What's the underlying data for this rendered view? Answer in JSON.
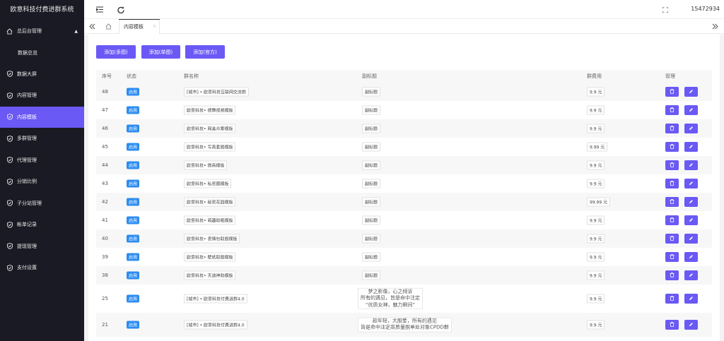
{
  "app": {
    "title": "欧意科技付费进群系统",
    "user": "15472934"
  },
  "sidebar": {
    "parent": {
      "label": "总后台管理"
    },
    "sub": {
      "label": "数据总览"
    },
    "items": [
      {
        "label": "数据大屏"
      },
      {
        "label": "内容管理"
      },
      {
        "label": "内容模板"
      },
      {
        "label": "多群管理"
      },
      {
        "label": "代理管理"
      },
      {
        "label": "分销比例"
      },
      {
        "label": "子分站管理"
      },
      {
        "label": "帐单记录"
      },
      {
        "label": "提现管理"
      },
      {
        "label": "支付设置"
      }
    ]
  },
  "tabs": {
    "active": "内容模板",
    "close": "×"
  },
  "toolbar": {
    "add_multi": "添加(多图)",
    "add_single": "添加(单图)",
    "add_official": "添加(官方)"
  },
  "table": {
    "headers": {
      "id": "序号",
      "status": "状态",
      "name": "群名称",
      "subtitle": "副标题",
      "fee": "群费用",
      "manage": "管理"
    },
    "rows": [
      {
        "id": "48",
        "status": "启用",
        "name": "[城市] • 欧意科技互联网交流群",
        "subtitle": [
          "副标题"
        ],
        "fee": "9.9 元"
      },
      {
        "id": "47",
        "status": "启用",
        "name": "欧意科技• 德舞视频模板",
        "subtitle": [
          "副标题"
        ],
        "fee": "9.9 元"
      },
      {
        "id": "46",
        "status": "启用",
        "name": "欧意科技• 网美众筹模板",
        "subtitle": [
          "副标题"
        ],
        "fee": "9.9 元"
      },
      {
        "id": "45",
        "status": "启用",
        "name": "欧意科技• 写真套图模板",
        "subtitle": [
          "副标题"
        ],
        "fee": "9.99 元"
      },
      {
        "id": "44",
        "status": "启用",
        "name": "欧意科技• 微商模板",
        "subtitle": [
          "副标题"
        ],
        "fee": "9.9 元"
      },
      {
        "id": "43",
        "status": "启用",
        "name": "欧意科技• 私密圈模板",
        "subtitle": [
          "副标题"
        ],
        "fee": "9.9 元"
      },
      {
        "id": "42",
        "status": "启用",
        "name": "欧意科技• 秘密花园模板",
        "subtitle": [
          "副标题"
        ],
        "fee": "99.99 元"
      },
      {
        "id": "41",
        "status": "启用",
        "name": "欧意科技• 萌趣助眠模板",
        "subtitle": [
          "副标题"
        ],
        "fee": "9.9 元"
      },
      {
        "id": "40",
        "status": "启用",
        "name": "欧意科技• 表情包取图模板",
        "subtitle": [
          "副标题"
        ],
        "fee": "9.9 元"
      },
      {
        "id": "39",
        "status": "启用",
        "name": "欧意科技• 壁纸取图模板",
        "subtitle": [
          "副标题"
        ],
        "fee": "9.9 元"
      },
      {
        "id": "38",
        "status": "启用",
        "name": "欧意科技• 天道神助模板",
        "subtitle": [
          "副标题"
        ],
        "fee": "9.9 元"
      },
      {
        "id": "25",
        "status": "启用",
        "name": "[城市] • 欧意科技付费进群4.0",
        "subtitle": [
          "梦之影像，心之倾诉",
          "所有的遇见，皆是命中注定",
          "“优质女神，魅力瞬间”"
        ],
        "fee": "9.9 元"
      },
      {
        "id": "21",
        "status": "启用",
        "name": "[城市] • 欧意科技付费进群4.0",
        "subtitle": [
          "趁年轻，大胆爱，所有的遇见",
          "皆是命中注定高质量脱单处对象CPDD群"
        ],
        "fee": "9.9 元"
      }
    ]
  },
  "colors": {
    "accent": "#6a59f5",
    "sidebar": "#191a23",
    "badge": "#2d8cf0"
  },
  "icons": {
    "fold": "fold-menu-icon",
    "refresh": "refresh-icon",
    "fullscreen": "fullscreen-icon",
    "home": "home-icon",
    "prev": "double-left-icon",
    "next": "double-right-icon",
    "delete": "trash-icon",
    "edit": "pencil-icon",
    "menu": "shield-check-icon"
  }
}
